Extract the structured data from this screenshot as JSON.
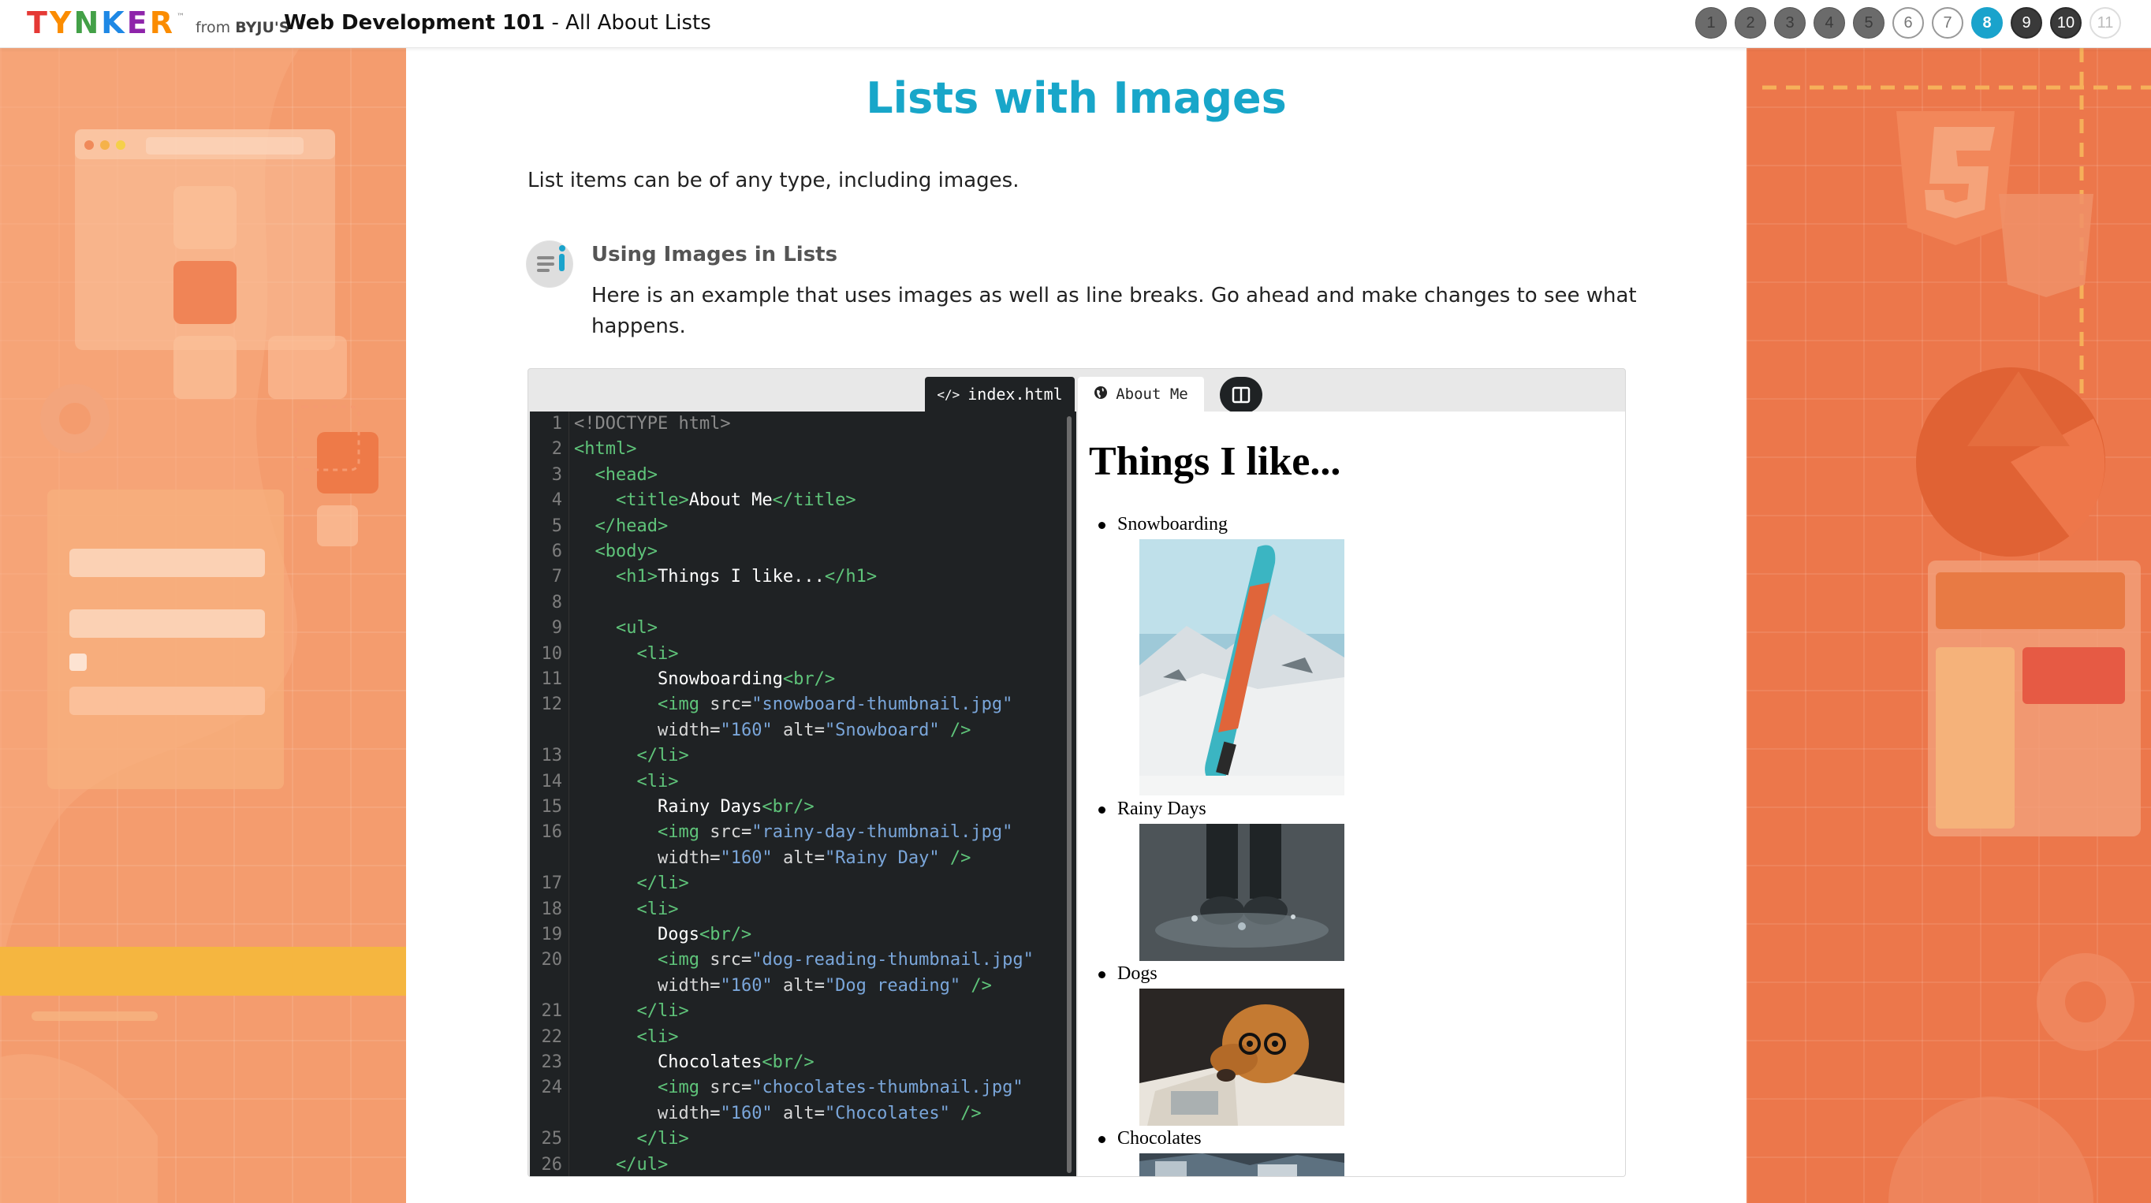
{
  "header": {
    "logo_text": "TYNKER",
    "from_text": "from",
    "from_brand": "BYJU'S",
    "course_title": "Web Development 101",
    "course_subtitle": " - All About Lists",
    "steps": [
      "1",
      "2",
      "3",
      "4",
      "5",
      "6",
      "7",
      "8",
      "9",
      "10",
      "11"
    ],
    "current_step": "8"
  },
  "lesson": {
    "title": "Lists with Images",
    "intro": "List items can be of any type, including images.",
    "tip_title": "Using Images in Lists",
    "tip_text": "Here is an example that uses images as well as line breaks. Go ahead and make changes to see what happens."
  },
  "ide": {
    "code_tab": "index.html",
    "preview_tab": "About Me"
  },
  "preview": {
    "heading": "Things I like...",
    "items": [
      "Snowboarding",
      "Rainy Days",
      "Dogs",
      "Chocolates"
    ],
    "image_alts": [
      "Snowboard",
      "Rainy Day",
      "Dog reading",
      "Chocolates"
    ]
  },
  "colors": {
    "accent": "#18a6c9",
    "left_panel": "#f49c6e",
    "right_panel": "#ec774b",
    "editor_bg": "#1f2224",
    "tag_green": "#5fc47a",
    "string_blue": "#7aa6da"
  }
}
